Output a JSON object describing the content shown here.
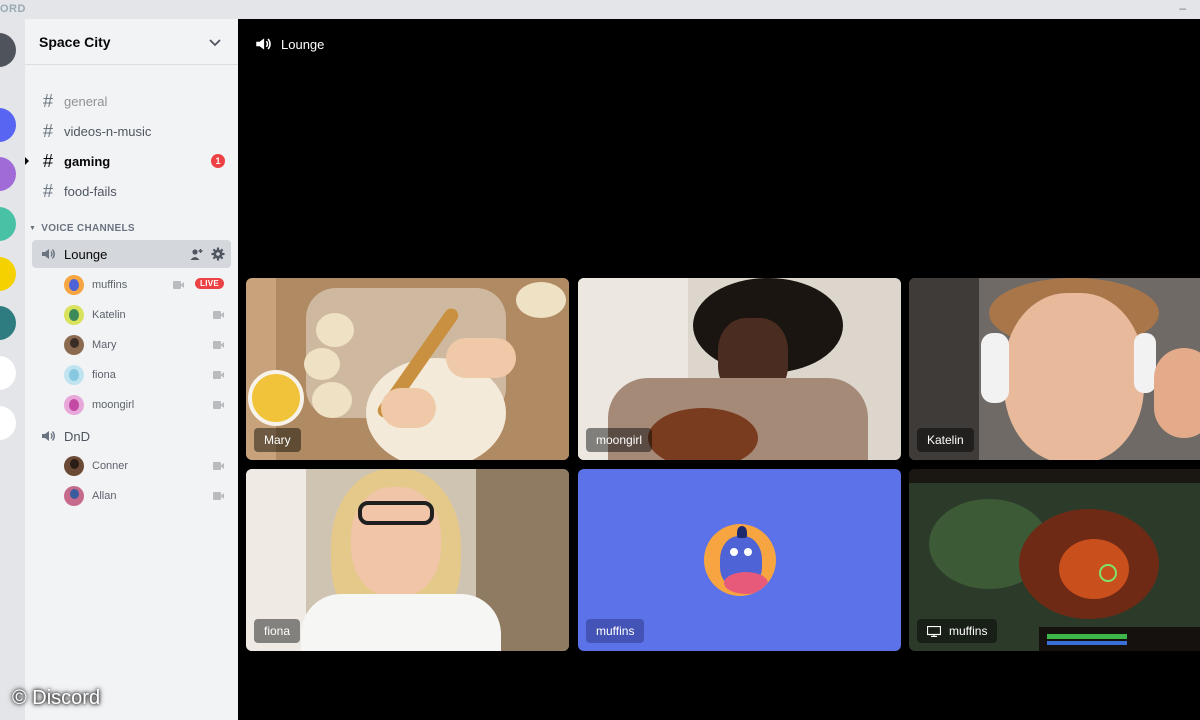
{
  "window": {
    "brand": "ORD",
    "minimize": "–"
  },
  "server": {
    "name": "Space City"
  },
  "channels": [
    {
      "name": "general",
      "state": "muted"
    },
    {
      "name": "videos-n-music",
      "state": "normal"
    },
    {
      "name": "gaming",
      "state": "unread",
      "badge": "1"
    },
    {
      "name": "food-fails",
      "state": "normal"
    }
  ],
  "voice_category": "VOICE CHANNELS",
  "voice_channels": [
    {
      "name": "Lounge",
      "selected": true,
      "users": [
        {
          "name": "muffins",
          "live": "LIVE"
        },
        {
          "name": "Katelin"
        },
        {
          "name": "Mary"
        },
        {
          "name": "fiona"
        },
        {
          "name": "moongirl"
        }
      ]
    },
    {
      "name": "DnD",
      "selected": false,
      "users": [
        {
          "name": "Conner"
        },
        {
          "name": "Allan"
        }
      ]
    }
  ],
  "stage": {
    "channel_title": "Lounge",
    "tiles": [
      {
        "name": "Mary",
        "kind": "video"
      },
      {
        "name": "moongirl",
        "kind": "video"
      },
      {
        "name": "Katelin",
        "kind": "video"
      },
      {
        "name": "fiona",
        "kind": "video"
      },
      {
        "name": "muffins",
        "kind": "avatar",
        "color": "#5b72e8"
      },
      {
        "name": "muffins",
        "kind": "screenshare"
      }
    ]
  },
  "watermark": "© Discord",
  "colors": {
    "accent": "#5865f2",
    "danger": "#ed4245",
    "sidebar": "#f2f3f5",
    "rail": "#e3e5e8"
  }
}
